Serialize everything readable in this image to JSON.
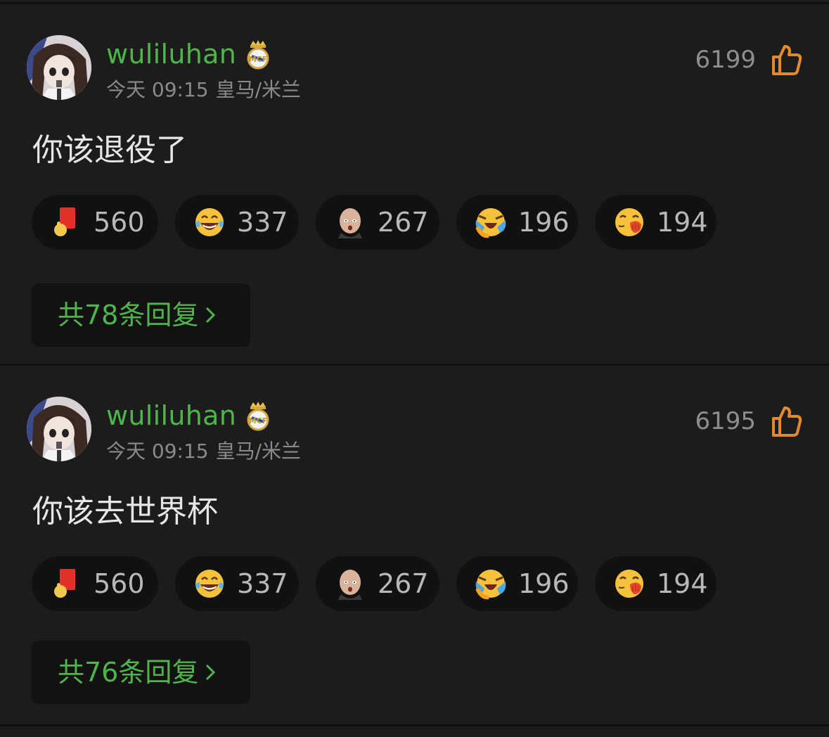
{
  "colors": {
    "background": "#1c1c1c",
    "username": "#4fb54a",
    "reply_link": "#4fb54a",
    "like_icon": "#e58a2c",
    "pill_bg": "#111111"
  },
  "comments": [
    {
      "username": "wuliluhan",
      "badge_icon": "real-madrid-badge-icon",
      "time": "今天 09:15",
      "team": "皇马/米兰",
      "like_count": "6199",
      "text": "你该退役了",
      "reactions": [
        {
          "icon": "red-card-icon",
          "count": "560"
        },
        {
          "icon": "tears-of-joy-icon",
          "count": "337"
        },
        {
          "icon": "bald-man-face-icon",
          "count": "267"
        },
        {
          "icon": "crying-laughing-face-icon",
          "count": "196"
        },
        {
          "icon": "shush-face-icon",
          "count": "194"
        }
      ],
      "replies_label": "共78条回复"
    },
    {
      "username": "wuliluhan",
      "badge_icon": "real-madrid-badge-icon",
      "time": "今天 09:15",
      "team": "皇马/米兰",
      "like_count": "6195",
      "text": "你该去世界杯",
      "reactions": [
        {
          "icon": "red-card-icon",
          "count": "560"
        },
        {
          "icon": "tears-of-joy-icon",
          "count": "337"
        },
        {
          "icon": "bald-man-face-icon",
          "count": "267"
        },
        {
          "icon": "crying-laughing-face-icon",
          "count": "196"
        },
        {
          "icon": "shush-face-icon",
          "count": "194"
        }
      ],
      "replies_label": "共76条回复"
    }
  ]
}
